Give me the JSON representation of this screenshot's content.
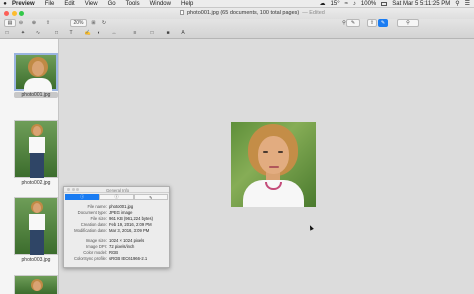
{
  "menubar": {
    "items": [
      "Preview",
      "File",
      "Edit",
      "View",
      "Go",
      "Tools",
      "Window",
      "Help"
    ],
    "temperature": "15°",
    "battery": "100%",
    "clock": "Sat Mar 5  5:11:25 PM"
  },
  "window": {
    "title": "photo001.jpg (65 documents, 100 total pages)",
    "edited": "— Edited"
  },
  "toolbar": {
    "zoom_value": "20%"
  },
  "sidebar": {
    "thumbnails": [
      {
        "label": "photo001.jpg",
        "selected": true
      },
      {
        "label": "photo002.jpg",
        "selected": false
      },
      {
        "label": "photo003.jpg",
        "selected": false
      }
    ]
  },
  "inspector": {
    "title": "General Info",
    "tabs": [
      "i",
      "i",
      "pen"
    ],
    "rows": [
      {
        "key": "File name:",
        "value": "photo001.jpg"
      },
      {
        "key": "Document type:",
        "value": "JPEG image"
      },
      {
        "key": "File size:",
        "value": "961 KB (961,224 bytes)"
      },
      {
        "key": "Creation date:",
        "value": "Feb 19, 2016, 2:09 PM"
      },
      {
        "key": "Modification date:",
        "value": "Mar 3, 2016, 3:09 PM"
      },
      {
        "key": "Image size:",
        "value": "1024 × 1024 pixels"
      },
      {
        "key": "Image DPI:",
        "value": "72 pixels/inch"
      },
      {
        "key": "Color model:",
        "value": "RGB"
      },
      {
        "key": "ColorSync profile:",
        "value": "sRGB IEC61966-2.1"
      }
    ]
  },
  "colors": {
    "accent": "#1a7cf2",
    "close": "#fc5f57",
    "minimize": "#fdbc2e",
    "zoom": "#34c84a"
  }
}
